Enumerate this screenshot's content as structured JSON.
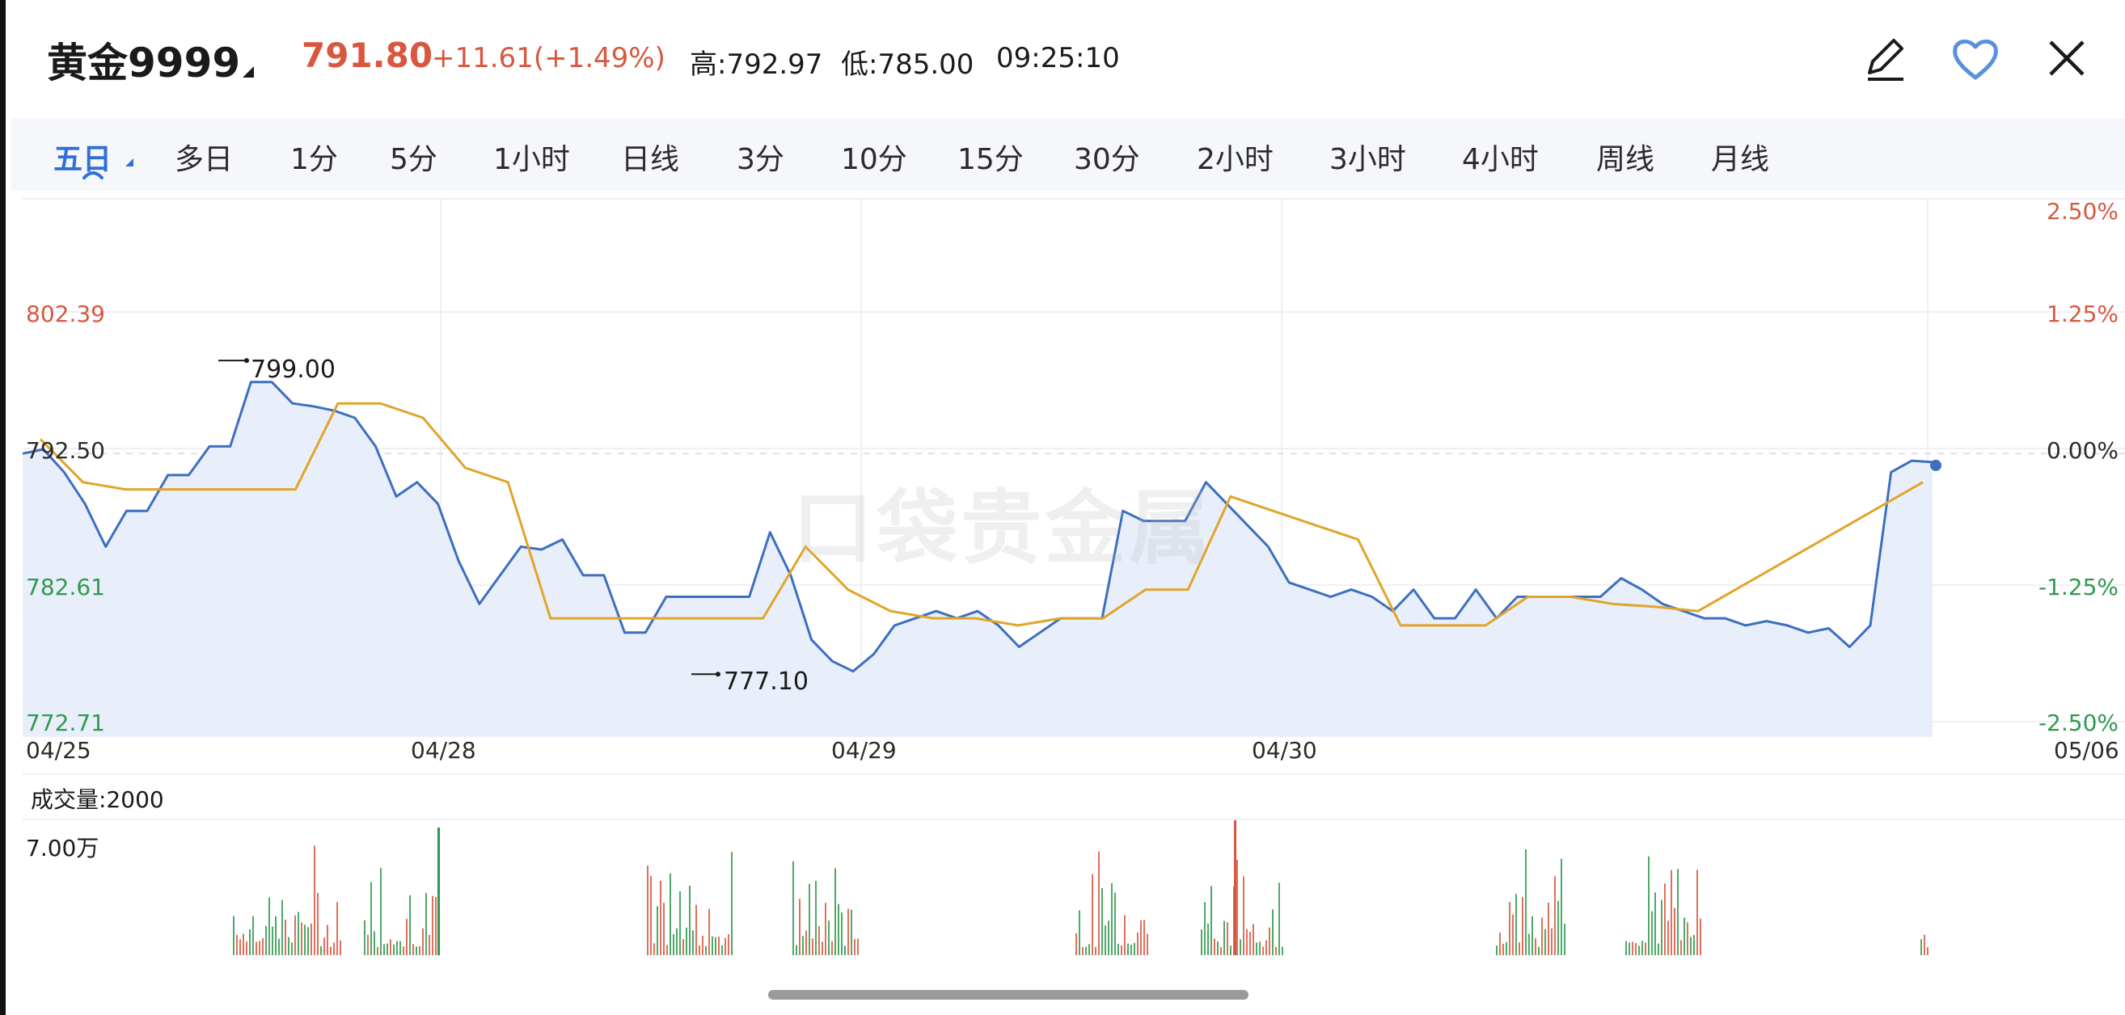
{
  "header": {
    "title": "黄金9999",
    "price": "791.80",
    "change": "+11.61(+1.49%)",
    "high": "高:792.97",
    "low": "低:785.00",
    "time": "09:25:10",
    "icons": [
      "edit-icon",
      "favorite-heart-icon",
      "close-icon"
    ]
  },
  "tabs": [
    {
      "label": "五日",
      "active": true
    },
    {
      "label": "多日"
    },
    {
      "label": "1分"
    },
    {
      "label": "5分"
    },
    {
      "label": "1小时"
    },
    {
      "label": "日线"
    },
    {
      "label": "3分"
    },
    {
      "label": "10分"
    },
    {
      "label": "15分"
    },
    {
      "label": "30分"
    },
    {
      "label": "2小时"
    },
    {
      "label": "3小时"
    },
    {
      "label": "4小时"
    },
    {
      "label": "周线"
    },
    {
      "label": "月线"
    }
  ],
  "chart": {
    "y_left": [
      "802.39",
      "792.50",
      "782.61",
      "772.71"
    ],
    "y_right": [
      "2.50%",
      "1.25%",
      "0.00%",
      "-1.25%",
      "-2.50%"
    ],
    "x_labels": [
      "04/25",
      "04/28",
      "04/29",
      "04/30",
      "05/06"
    ],
    "annotation_high": "799.00",
    "annotation_low": "777.10",
    "watermark": "口袋贵金属",
    "volume_title": "成交量:2000",
    "volume_max": "7.00万"
  },
  "colors": {
    "up": "#d9573f",
    "down": "#2e9a4e",
    "price_line": "#3d6fbf",
    "avg_line": "#e0a52a",
    "area_fill": "#e9effa",
    "accent": "#2f6fd6"
  },
  "chart_data": {
    "type": "line",
    "title": "黄金9999",
    "x": [
      "04/25",
      "04/28",
      "04/29",
      "04/30",
      "05/06"
    ],
    "ylim": [
      772.71,
      802.39
    ],
    "y_right_range_pct": [
      -2.5,
      2.5
    ],
    "reference_price": 792.5,
    "grid": true,
    "series": [
      {
        "values": [
          792.5,
          792.8,
          791.2,
          789.0,
          786.0,
          788.5,
          788.5,
          791.0,
          791.0,
          793.0,
          793.0,
          797.5,
          797.5,
          796.0,
          795.8,
          795.5,
          795.0,
          793.0,
          789.5,
          790.5,
          789.0,
          785.0,
          782.0,
          784.0,
          786.0,
          785.8,
          786.5,
          784.0,
          784.0,
          780.0,
          780.0,
          782.5,
          782.5,
          782.5,
          782.5,
          782.5,
          787.0,
          784.0,
          779.5,
          778.0,
          777.3,
          778.5,
          780.5,
          781.0,
          781.5,
          781.0,
          781.5,
          780.5,
          779.0,
          780.0,
          781.0,
          781.0,
          781.0,
          788.5,
          787.8,
          787.8,
          787.8,
          790.5,
          789.0,
          787.5,
          786.0,
          783.5,
          783.0,
          782.5,
          783.0,
          782.5,
          781.5,
          783.0,
          781.0,
          781.0,
          783.0,
          781.0,
          782.5,
          782.5,
          782.5,
          782.5,
          782.5,
          783.8,
          783.0,
          782.0,
          781.5,
          781.0,
          781.0,
          780.5,
          780.8,
          780.5,
          780.0,
          780.3,
          779.0,
          780.5,
          791.2,
          792.0,
          791.9
        ]
      }
    ],
    "avg_series_approx": [
      793.5,
      790.5,
      790.0,
      790.0,
      790.0,
      790.0,
      790.0,
      796.0,
      796.0,
      795.0,
      791.5,
      790.5,
      781.0,
      781.0,
      781.0,
      781.0,
      781.0,
      781.0,
      786.0,
      783.0,
      781.5,
      781.0,
      781.0,
      780.5,
      781.0,
      781.0,
      783.0,
      783.0,
      789.5,
      788.5,
      787.5,
      786.5,
      780.5,
      780.5,
      780.5,
      782.5,
      782.5,
      782.0,
      781.8,
      781.5,
      790.5
    ]
  }
}
